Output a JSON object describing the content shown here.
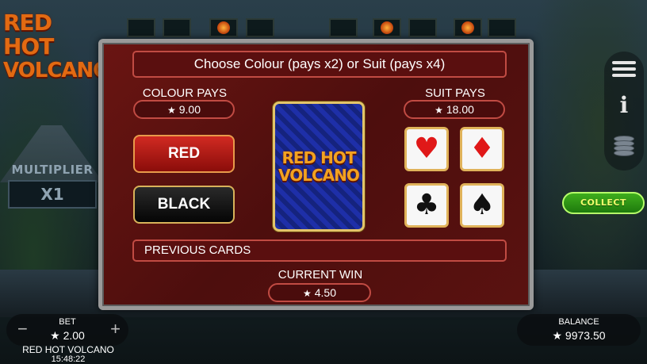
{
  "game": {
    "logo_line1": "RED HOT",
    "logo_line2": "VOLCANO",
    "name": "RED HOT VOLCANO",
    "clock": "15:48:22"
  },
  "multiplier": {
    "label": "MULTIPLIER",
    "value": "X1"
  },
  "gamble": {
    "header": "Choose Colour (pays x2) or Suit (pays x4)",
    "colour_pays_label": "COLOUR PAYS",
    "colour_pays_value": "9.00",
    "suit_pays_label": "SUIT PAYS",
    "suit_pays_value": "18.00",
    "red_label": "RED",
    "black_label": "BLACK",
    "card_logo_line1": "RED HOT",
    "card_logo_line2": "VOLCANO",
    "suits": [
      {
        "name": "hearts",
        "glyph": "♥",
        "color": "red"
      },
      {
        "name": "diamonds",
        "glyph": "♦",
        "color": "red"
      },
      {
        "name": "clubs",
        "glyph": "♣",
        "color": "black"
      },
      {
        "name": "spades",
        "glyph": "♠",
        "color": "black"
      }
    ],
    "previous_cards_label": "PREVIOUS CARDS",
    "current_win_label": "CURRENT WIN",
    "current_win_value": "4.50"
  },
  "collect_label": "COLLECT",
  "bet": {
    "label": "BET",
    "value": "2.00",
    "minus": "−",
    "plus": "+"
  },
  "balance": {
    "label": "BALANCE",
    "value": "9973.50"
  },
  "star": "★",
  "icons": {
    "menu": "hamburger-icon",
    "info": "info-icon",
    "coins": "coin-stack-icon"
  },
  "colors": {
    "panel_red": "#5a0f0f",
    "border_red": "#c14b43",
    "gold": "#e3c46a",
    "collect_green": "#3fae1d"
  }
}
